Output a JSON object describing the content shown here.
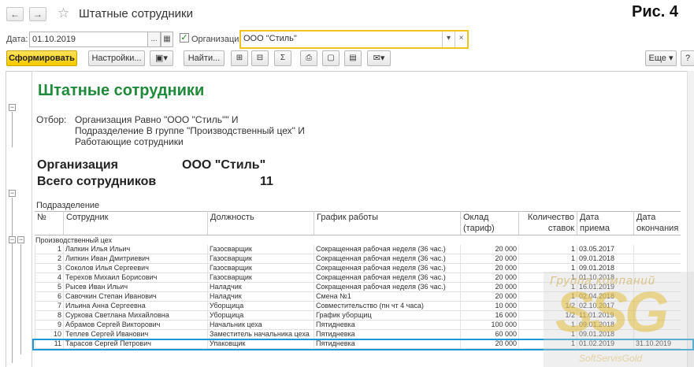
{
  "window": {
    "title": "Штатные сотрудники",
    "figure_label": "Рис. 4"
  },
  "params": {
    "date_label": "Дата:",
    "date_value": "01.10.2019",
    "org_label": "Организация:",
    "org_value": "ООО \"Стиль\"",
    "org_checked": "✓"
  },
  "toolbar": {
    "generate": "Сформировать",
    "settings": "Настройки...",
    "find": "Найти...",
    "more": "Еще ▾",
    "help": "?",
    "sum": "Σ"
  },
  "report": {
    "title": "Штатные сотрудники",
    "filter_label": "Отбор:",
    "filter_lines": [
      "Организация Равно \"ООО \"Стиль\"\" И",
      "Подразделение В группе \"Производственный цех\" И",
      "Работающие сотрудники"
    ],
    "org_caption": "Организация",
    "org_name": "ООО \"Стиль\"",
    "total_caption": "Всего сотрудников",
    "total_count": "11",
    "subdivision_caption": "Подразделение",
    "columns": {
      "num": "№",
      "employee": "Сотрудник",
      "position": "Должность",
      "schedule": "График работы",
      "salary1": "Оклад",
      "salary2": "(тариф)",
      "rates1": "Количество",
      "rates2": "ставок",
      "hire1": "Дата",
      "hire2": "приема",
      "end1": "Дата",
      "end2": "окончания"
    },
    "group_name": "Производственный цех",
    "rows": [
      {
        "n": "1",
        "name": "Лапкин Илья Ильич",
        "pos": "Газосварщик",
        "sched": "Сокращенная рабочая неделя (36 час.)",
        "sal": "20 000",
        "rate": "1",
        "hire": "03.05.2017",
        "end": ""
      },
      {
        "n": "2",
        "name": "Липкин Иван Дмитриевич",
        "pos": "Газосварщик",
        "sched": "Сокращенная рабочая неделя (36 час.)",
        "sal": "20 000",
        "rate": "1",
        "hire": "09.01.2018",
        "end": ""
      },
      {
        "n": "3",
        "name": "Соколов Илья Сергеевич",
        "pos": "Газосварщик",
        "sched": "Сокращенная рабочая неделя (36 час.)",
        "sal": "20 000",
        "rate": "1",
        "hire": "09.01.2018",
        "end": ""
      },
      {
        "n": "4",
        "name": "Терехов Михаил Борисович",
        "pos": "Газосварщик",
        "sched": "Сокращенная рабочая неделя (36 час.)",
        "sal": "20 000",
        "rate": "1",
        "hire": "01.10.2018",
        "end": ""
      },
      {
        "n": "5",
        "name": "Рысев Иван Ильич",
        "pos": "Наладчик",
        "sched": "Сокращенная рабочая неделя (36 час.)",
        "sal": "20 000",
        "rate": "1",
        "hire": "16.01.2019",
        "end": ""
      },
      {
        "n": "6",
        "name": "Савочкин Степан Иванович",
        "pos": "Наладчик",
        "sched": "Смена №1",
        "sal": "20 000",
        "rate": "1",
        "hire": "02.04.2018",
        "end": ""
      },
      {
        "n": "7",
        "name": "Ильина Анна Сергеевна",
        "pos": "Уборщица",
        "sched": "Совместительство (пн чт 4 часа)",
        "sal": "10 000",
        "rate": "1/2",
        "hire": "02.10.2017",
        "end": ""
      },
      {
        "n": "8",
        "name": "Суркова Светлана Михайловна",
        "pos": "Уборщица",
        "sched": "График уборщиц",
        "sal": "16 000",
        "rate": "1/2",
        "hire": "11.01.2019",
        "end": ""
      },
      {
        "n": "9",
        "name": "Абрамов Сергей Викторович",
        "pos": "Начальник цеха",
        "sched": "Пятидневка",
        "sal": "100 000",
        "rate": "1",
        "hire": "09.01.2018",
        "end": ""
      },
      {
        "n": "10",
        "name": "Теплев Сергей Иванович",
        "pos": "Заместитель начальника цеха",
        "sched": "Пятидневка",
        "sal": "60 000",
        "rate": "1",
        "hire": "09.01.2018",
        "end": ""
      },
      {
        "n": "11",
        "name": "Тарасов Сергей Петрович",
        "pos": "Упаковщик",
        "sched": "Пятидневка",
        "sal": "20 000",
        "rate": "1",
        "hire": "01.02.2019",
        "end": "31.10.2019"
      }
    ]
  },
  "watermark": {
    "top": "Группа компаний",
    "logo": "SSG",
    "bottom": "SoftServisGold"
  }
}
